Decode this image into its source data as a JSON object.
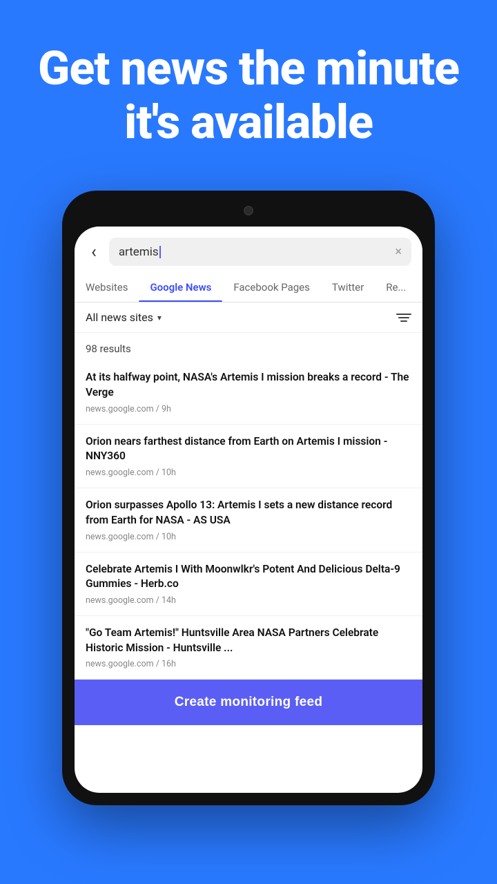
{
  "hero": {
    "title": "Get news the minute it's available",
    "background_color": "#2979ff"
  },
  "phone": {
    "search": {
      "value": "artemis",
      "clear_label": "×"
    },
    "tabs": [
      {
        "label": "Websites",
        "active": false
      },
      {
        "label": "Google News",
        "active": true
      },
      {
        "label": "Facebook Pages",
        "active": false
      },
      {
        "label": "Twitter",
        "active": false
      },
      {
        "label": "Re...",
        "active": false
      }
    ],
    "filter": {
      "dropdown_label": "All news sites",
      "chevron": "▾"
    },
    "results": {
      "count_label": "98 results"
    },
    "news_items": [
      {
        "title": "At its halfway point, NASA's Artemis I mission breaks a record - The Verge",
        "source": "news.google.com",
        "time": "9h"
      },
      {
        "title": "Orion nears farthest distance from Earth on Artemis I mission - NNY360",
        "source": "news.google.com",
        "time": "10h"
      },
      {
        "title": "Orion surpasses Apollo 13: Artemis I sets a new distance record from Earth for NASA - AS USA",
        "source": "news.google.com",
        "time": "10h"
      },
      {
        "title": "Celebrate Artemis I With Moonwlkr's Potent And Delicious Delta-9 Gummies - Herb.co",
        "source": "news.google.com",
        "time": "14h"
      },
      {
        "title": "\"Go Team Artemis!\" Huntsville Area NASA Partners Celebrate Historic Mission - Huntsville ...",
        "source": "news.google.com",
        "time": "16h"
      }
    ],
    "create_btn_label": "Create monitoring feed"
  }
}
